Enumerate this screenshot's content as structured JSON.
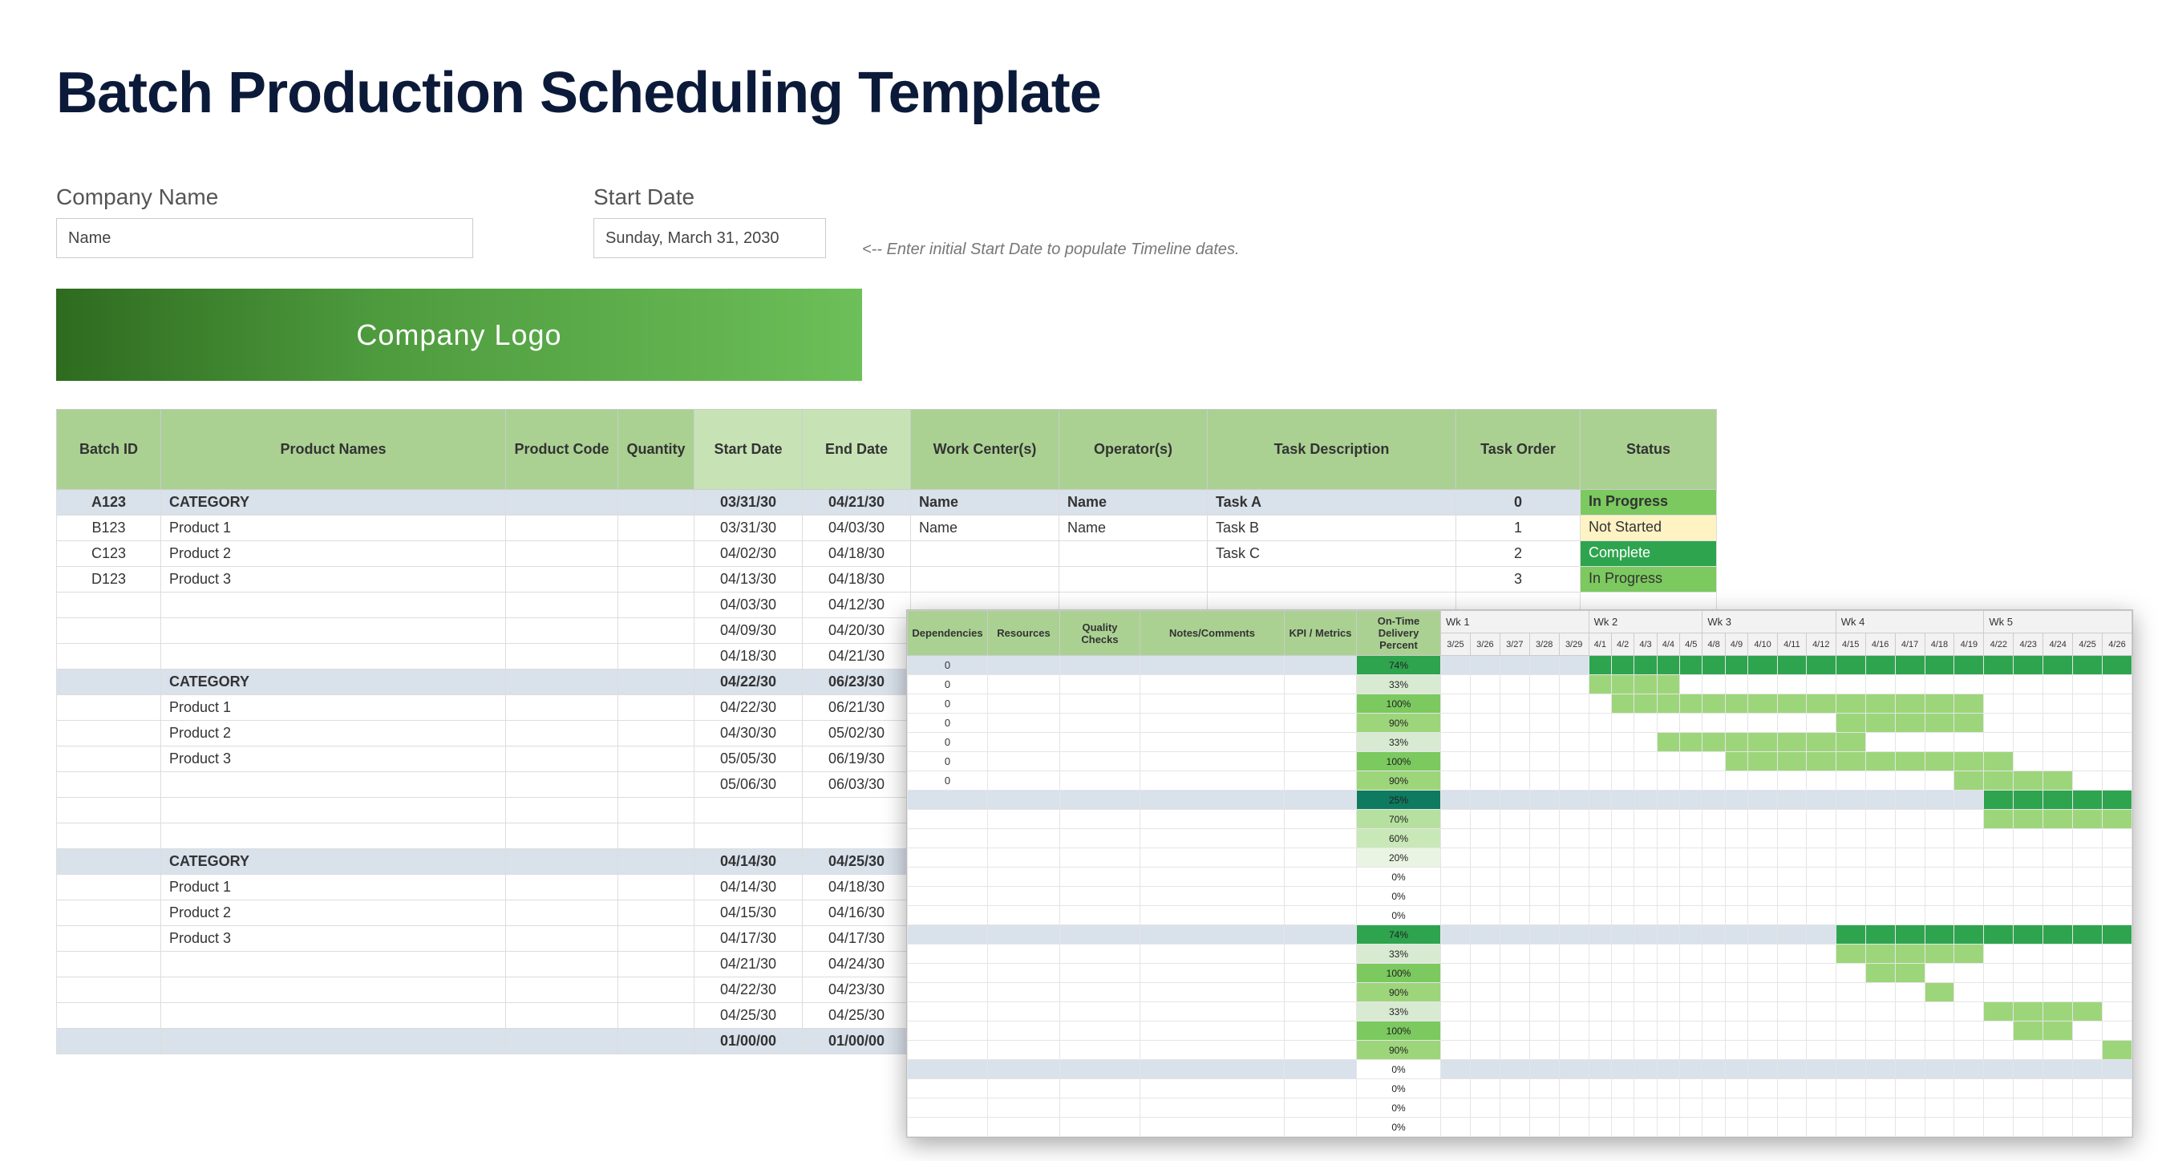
{
  "title": "Batch Production Scheduling Template",
  "fields": {
    "company_label": "Company Name",
    "company_value": "Name",
    "start_date_label": "Start Date",
    "start_date_value": "Sunday, March 31, 2030",
    "hint": "<-- Enter initial Start Date to populate Timeline dates."
  },
  "logo_text": "Company Logo",
  "main_headers": {
    "batch": "Batch ID",
    "name": "Product Names",
    "code": "Product Code",
    "qty": "Quantity",
    "start": "Start Date",
    "end": "End Date",
    "wc": "Work Center(s)",
    "op": "Operator(s)",
    "desc": "Task Description",
    "order": "Task Order",
    "status": "Status"
  },
  "main_rows": [
    {
      "type": "category",
      "batch": "A123",
      "name": "CATEGORY",
      "start": "03/31/30",
      "end": "04/21/30",
      "wc": "Name",
      "op": "Name",
      "desc": "Task A",
      "order": "0",
      "status": "In Progress",
      "status_class": "status-in-progress",
      "bold": true
    },
    {
      "type": "row",
      "batch": "B123",
      "name": "Product 1",
      "start": "03/31/30",
      "end": "04/03/30",
      "wc": "Name",
      "op": "Name",
      "desc": "Task B",
      "order": "1",
      "status": "Not Started",
      "status_class": "status-not-started"
    },
    {
      "type": "row",
      "batch": "C123",
      "name": "Product 2",
      "start": "04/02/30",
      "end": "04/18/30",
      "wc": "",
      "op": "",
      "desc": "Task C",
      "order": "2",
      "status": "Complete",
      "status_class": "status-complete"
    },
    {
      "type": "row",
      "batch": "D123",
      "name": "Product 3",
      "start": "04/13/30",
      "end": "04/18/30",
      "wc": "",
      "op": "",
      "desc": "",
      "order": "3",
      "status": "In Progress",
      "status_class": "status-in-progress"
    },
    {
      "type": "row",
      "batch": "",
      "name": "",
      "start": "04/03/30",
      "end": "04/12/30"
    },
    {
      "type": "row",
      "batch": "",
      "name": "",
      "start": "04/09/30",
      "end": "04/20/30"
    },
    {
      "type": "row",
      "batch": "",
      "name": "",
      "start": "04/18/30",
      "end": "04/21/30"
    },
    {
      "type": "category",
      "batch": "",
      "name": "CATEGORY",
      "start": "04/22/30",
      "end": "06/23/30",
      "bold": true
    },
    {
      "type": "row",
      "batch": "",
      "name": "Product 1",
      "start": "04/22/30",
      "end": "06/21/30"
    },
    {
      "type": "row",
      "batch": "",
      "name": "Product 2",
      "start": "04/30/30",
      "end": "05/02/30"
    },
    {
      "type": "row",
      "batch": "",
      "name": "Product 3",
      "start": "05/05/30",
      "end": "06/19/30"
    },
    {
      "type": "row",
      "batch": "",
      "name": "",
      "start": "05/06/30",
      "end": "06/03/30"
    },
    {
      "type": "row",
      "batch": "",
      "name": ""
    },
    {
      "type": "row",
      "batch": "",
      "name": ""
    },
    {
      "type": "category",
      "batch": "",
      "name": "CATEGORY",
      "start": "04/14/30",
      "end": "04/25/30",
      "bold": true
    },
    {
      "type": "row",
      "batch": "",
      "name": "Product 1",
      "start": "04/14/30",
      "end": "04/18/30"
    },
    {
      "type": "row",
      "batch": "",
      "name": "Product 2",
      "start": "04/15/30",
      "end": "04/16/30"
    },
    {
      "type": "row",
      "batch": "",
      "name": "Product 3",
      "start": "04/17/30",
      "end": "04/17/30"
    },
    {
      "type": "row",
      "batch": "",
      "name": "",
      "start": "04/21/30",
      "end": "04/24/30"
    },
    {
      "type": "row",
      "batch": "",
      "name": "",
      "start": "04/22/30",
      "end": "04/23/30"
    },
    {
      "type": "row",
      "batch": "",
      "name": "",
      "start": "04/25/30",
      "end": "04/25/30"
    },
    {
      "type": "summary",
      "batch": "",
      "name": "",
      "start": "01/00/00",
      "end": "01/00/00",
      "bold": true
    }
  ],
  "detail_headers": {
    "dep": "Dependencies",
    "res": "Resources",
    "qc": "Quality Checks",
    "notes": "Notes/Comments",
    "kpi": "KPI / Metrics",
    "ot": "On-Time Delivery Percent"
  },
  "weeks": [
    "Wk 1",
    "Wk 2",
    "Wk 3",
    "Wk 4",
    "Wk 5"
  ],
  "days": [
    "3/25",
    "3/26",
    "3/27",
    "3/28",
    "3/29",
    "4/1",
    "4/2",
    "4/3",
    "4/4",
    "4/5",
    "4/8",
    "4/9",
    "4/10",
    "4/11",
    "4/12",
    "4/15",
    "4/16",
    "4/17",
    "4/18",
    "4/19",
    "4/22",
    "4/23",
    "4/24",
    "4/25",
    "4/26"
  ],
  "detail_rows": [
    {
      "type": "cat",
      "dep": "0",
      "ot": "74%",
      "ot_color": "#2ea44f",
      "gantt": [
        [
          5,
          25,
          "dark"
        ]
      ]
    },
    {
      "type": "row",
      "dep": "0",
      "ot": "33%",
      "ot_color": "#d9ead3",
      "gantt": [
        [
          5,
          8,
          "light"
        ]
      ]
    },
    {
      "type": "row",
      "dep": "0",
      "ot": "100%",
      "ot_color": "#7bc95f",
      "gantt": [
        [
          6,
          19,
          "light"
        ]
      ]
    },
    {
      "type": "row",
      "dep": "0",
      "ot": "90%",
      "ot_color": "#9dd67a",
      "gantt": [
        [
          15,
          19,
          "light"
        ]
      ]
    },
    {
      "type": "row",
      "dep": "0",
      "ot": "33%",
      "ot_color": "#d9ead3",
      "gantt": [
        [
          8,
          15,
          "light"
        ]
      ]
    },
    {
      "type": "row",
      "dep": "0",
      "ot": "100%",
      "ot_color": "#7bc95f",
      "gantt": [
        [
          11,
          20,
          "light"
        ]
      ]
    },
    {
      "type": "row",
      "dep": "0",
      "ot": "90%",
      "ot_color": "#9dd67a",
      "gantt": [
        [
          19,
          22,
          "light"
        ]
      ]
    },
    {
      "type": "cat",
      "dep": "",
      "ot": "25%",
      "ot_color": "#0e7a5f",
      "gantt": [
        [
          20,
          25,
          "dark"
        ]
      ]
    },
    {
      "type": "row",
      "dep": "",
      "ot": "70%",
      "ot_color": "#b6e0a0",
      "gantt": [
        [
          20,
          25,
          "light"
        ]
      ]
    },
    {
      "type": "row",
      "dep": "",
      "ot": "60%",
      "ot_color": "#c9e8b7",
      "gantt": []
    },
    {
      "type": "row",
      "dep": "",
      "ot": "20%",
      "ot_color": "#eaf4e2",
      "gantt": []
    },
    {
      "type": "row",
      "dep": "",
      "ot": "0%",
      "ot_color": "#ffffff",
      "gantt": []
    },
    {
      "type": "row",
      "dep": "",
      "ot": "0%",
      "ot_color": "#ffffff",
      "gantt": []
    },
    {
      "type": "row",
      "dep": "",
      "ot": "0%",
      "ot_color": "#ffffff",
      "gantt": []
    },
    {
      "type": "cat",
      "dep": "",
      "ot": "74%",
      "ot_color": "#2ea44f",
      "gantt": [
        [
          15,
          25,
          "dark"
        ]
      ]
    },
    {
      "type": "row",
      "dep": "",
      "ot": "33%",
      "ot_color": "#d9ead3",
      "gantt": [
        [
          15,
          19,
          "light"
        ]
      ]
    },
    {
      "type": "row",
      "dep": "",
      "ot": "100%",
      "ot_color": "#7bc95f",
      "gantt": [
        [
          16,
          17,
          "light"
        ]
      ]
    },
    {
      "type": "row",
      "dep": "",
      "ot": "90%",
      "ot_color": "#9dd67a",
      "gantt": [
        [
          18,
          18,
          "light"
        ]
      ]
    },
    {
      "type": "row",
      "dep": "",
      "ot": "33%",
      "ot_color": "#d9ead3",
      "gantt": [
        [
          20,
          23,
          "light"
        ]
      ]
    },
    {
      "type": "row",
      "dep": "",
      "ot": "100%",
      "ot_color": "#7bc95f",
      "gantt": [
        [
          21,
          22,
          "light"
        ]
      ]
    },
    {
      "type": "row",
      "dep": "",
      "ot": "90%",
      "ot_color": "#9dd67a",
      "gantt": [
        [
          24,
          24,
          "light"
        ]
      ]
    },
    {
      "type": "cat",
      "dep": "",
      "ot": "0%",
      "ot_color": "#ffffff",
      "gantt": []
    },
    {
      "type": "row",
      "dep": "",
      "ot": "0%",
      "ot_color": "#ffffff",
      "gantt": []
    },
    {
      "type": "row",
      "dep": "",
      "ot": "0%",
      "ot_color": "#ffffff",
      "gantt": []
    },
    {
      "type": "row",
      "dep": "",
      "ot": "0%",
      "ot_color": "#ffffff",
      "gantt": []
    }
  ]
}
